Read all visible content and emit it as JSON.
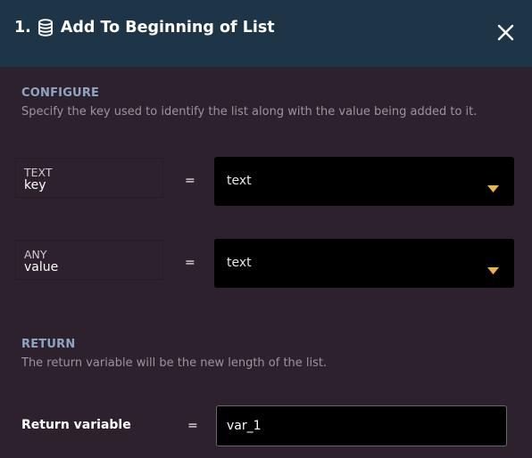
{
  "header": {
    "step_number": "1.",
    "title": "Add To Beginning of List",
    "icon": "database-icon",
    "close_icon": "close-icon",
    "background": "#1e3547"
  },
  "configure": {
    "heading": "CONFIGURE",
    "description": "Specify the key used to identify the list along with the value being added to it."
  },
  "params": [
    {
      "type": "TEXT",
      "name": "key",
      "equals": "=",
      "selected": "text"
    },
    {
      "type": "ANY",
      "name": "value",
      "equals": "=",
      "selected": "text"
    }
  ],
  "return_section": {
    "heading": "RETURN",
    "description": "The return variable will be the new length of the list.",
    "label": "Return variable",
    "equals": "=",
    "value": "var_1"
  },
  "colors": {
    "panel_bg": "#2d212e",
    "accent_caret": "#e8b54c",
    "section_heading": "#8ea6c2"
  }
}
